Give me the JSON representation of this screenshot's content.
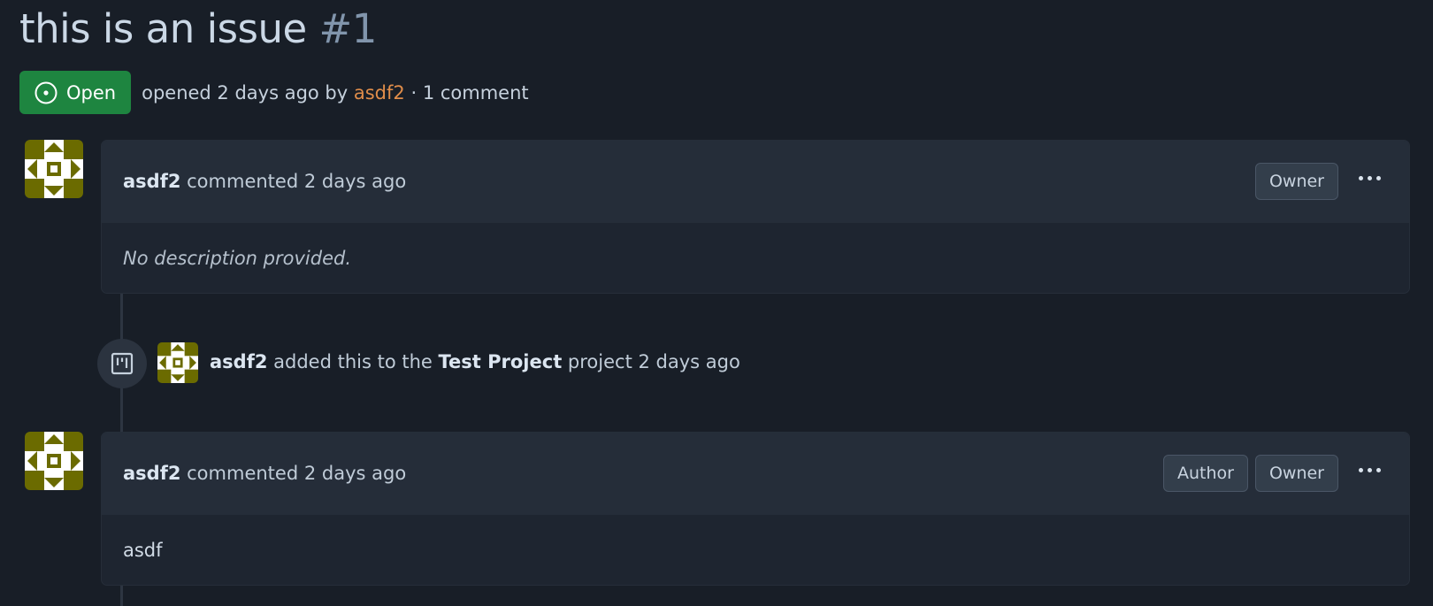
{
  "issue": {
    "title": "this is an issue",
    "number": "#1",
    "state": "Open",
    "meta_prefix": "opened 2 days ago by",
    "author": "asdf2",
    "meta_suffix": "· 1 comment"
  },
  "comments": [
    {
      "user": "asdf2",
      "action": "commented 2 days ago",
      "badges": [
        "Owner"
      ],
      "body": "No description provided."
    },
    {
      "user": "asdf2",
      "action": "commented 2 days ago",
      "badges": [
        "Author",
        "Owner"
      ],
      "body": "asdf"
    }
  ],
  "event": {
    "user": "asdf2",
    "text_before": "added this to the",
    "project": "Test Project",
    "text_after": "project 2 days ago",
    "icon": "project-board-icon"
  },
  "colors": {
    "open_badge": "#1e8540",
    "author_link": "#e08d4a",
    "avatar_olive": "#6b6b00"
  }
}
